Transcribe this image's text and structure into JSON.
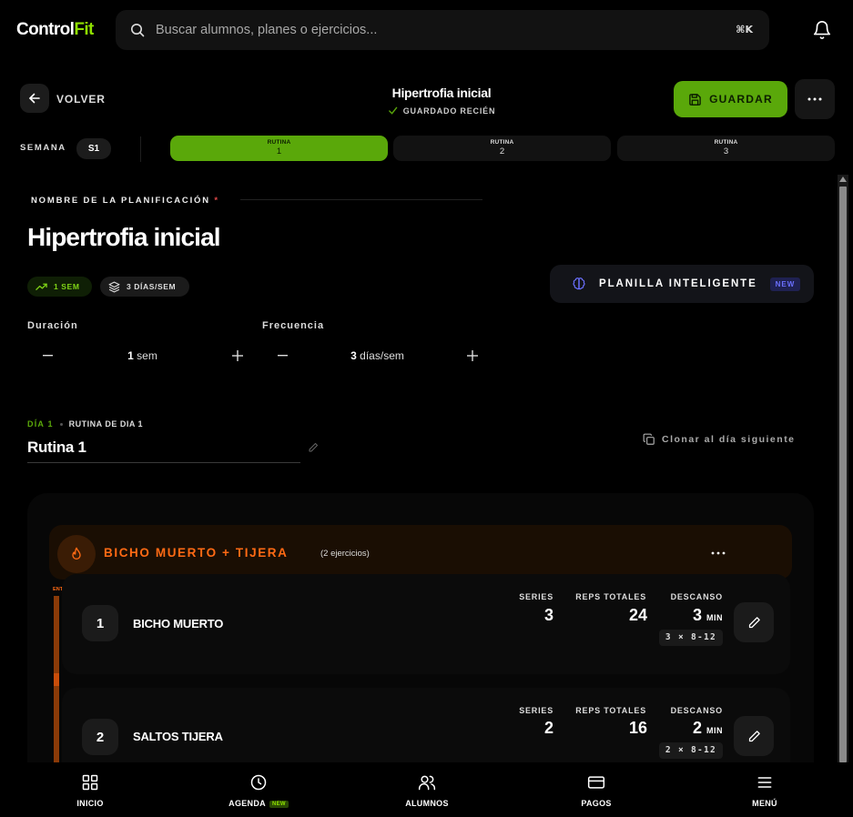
{
  "brand": {
    "part1": "Control",
    "part2": "Fit"
  },
  "search": {
    "placeholder": "Buscar alumnos, planes o ejercicios...",
    "shortcut": "⌘K"
  },
  "header": {
    "back_label": "VOLVER",
    "title": "Hipertrofia inicial",
    "status": "GUARDADO RECIÉN",
    "save_label": "GUARDAR"
  },
  "week": {
    "label": "SEMANA",
    "current": "S1",
    "routines": [
      {
        "label": "RUTINA",
        "number": "1",
        "active": true
      },
      {
        "label": "RUTINA",
        "number": "2",
        "active": false
      },
      {
        "label": "RUTINA",
        "number": "3",
        "active": false
      }
    ]
  },
  "plan": {
    "name_label": "NOMBRE DE LA PLANIFICACIÓN",
    "required_mark": "*",
    "name": "Hipertrofia inicial",
    "badge_weeks": "1 SEM",
    "badge_days": "3 DÍAS/SEM",
    "smart_button": "PLANILLA INTELIGENTE",
    "smart_badge": "NEW",
    "duration_label": "Duración",
    "duration_value": "1",
    "duration_unit": "sem",
    "frequency_label": "Frecuencia",
    "frequency_value": "3",
    "frequency_unit": "días/sem"
  },
  "day": {
    "label": "DÍA 1",
    "sub": "RUTINA DE DIA 1",
    "routine_name": "Rutina 1",
    "clone_label": "Clonar al día siguiente"
  },
  "block": {
    "title": "BICHO MUERTO + TIJERA",
    "count": "(2 ejercicios)",
    "phase": "ENTRADA EN CALOR",
    "stat_labels": {
      "series": "SERIES",
      "reps": "REPS TOTALES",
      "rest": "DESCANSO"
    },
    "rest_unit": "MIN",
    "exercises": [
      {
        "number": "1",
        "name": "BICHO MUERTO",
        "series": "3",
        "reps": "24",
        "rest": "3",
        "scheme": "3 × 8-12"
      },
      {
        "number": "2",
        "name": "SALTOS TIJERA",
        "series": "2",
        "reps": "16",
        "rest": "2",
        "scheme": "2 × 8-12"
      }
    ]
  },
  "nav": [
    {
      "label": "INICIO",
      "icon": "grid-icon"
    },
    {
      "label": "AGENDA",
      "icon": "clock-icon",
      "badge": "NEW"
    },
    {
      "label": "ALUMNOS",
      "icon": "users-icon"
    },
    {
      "label": "PAGOS",
      "icon": "card-icon"
    },
    {
      "label": "MENÚ",
      "icon": "menu-icon"
    }
  ],
  "colors": {
    "accent": "#5aa80a",
    "brand_green": "#8fe000",
    "orange": "#ff6a14",
    "new_badge": "#6b70ff"
  }
}
